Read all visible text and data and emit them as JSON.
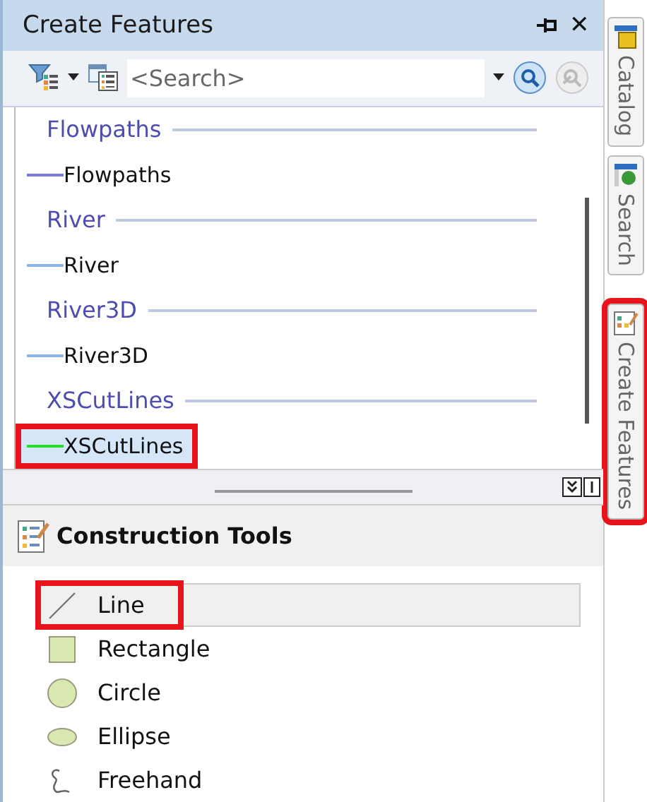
{
  "panel": {
    "title": "Create Features",
    "close_glyph": "✕"
  },
  "toolbar": {
    "search": {
      "placeholder": "<Search>"
    }
  },
  "templates": [
    {
      "group": "Flowpaths",
      "items": [
        {
          "name": "Flowpaths",
          "color": "#7b7bd8",
          "selected": false,
          "highlighted": false
        }
      ]
    },
    {
      "group": "River",
      "items": [
        {
          "name": "River",
          "color": "#8ab4e8",
          "selected": false,
          "highlighted": false
        }
      ]
    },
    {
      "group": "River3D",
      "items": [
        {
          "name": "River3D",
          "color": "#8ab4e8",
          "selected": false,
          "highlighted": false
        }
      ]
    },
    {
      "group": "XSCutLines",
      "items": [
        {
          "name": "XSCutLines",
          "color": "#22dd22",
          "selected": true,
          "highlighted": true
        }
      ]
    }
  ],
  "construction_tools": {
    "title": "Construction Tools",
    "tools": [
      {
        "kind": "line",
        "label": "Line",
        "selected": true,
        "highlighted": true
      },
      {
        "kind": "rectangle",
        "label": "Rectangle",
        "selected": false,
        "highlighted": false
      },
      {
        "kind": "circle",
        "label": "Circle",
        "selected": false,
        "highlighted": false
      },
      {
        "kind": "ellipse",
        "label": "Ellipse",
        "selected": false,
        "highlighted": false
      },
      {
        "kind": "freehand",
        "label": "Freehand",
        "selected": false,
        "highlighted": false
      }
    ]
  },
  "side_tabs": [
    {
      "kind": "catalog",
      "label": "Catalog",
      "highlighted": false
    },
    {
      "kind": "search",
      "label": "Search",
      "highlighted": false
    },
    {
      "kind": "create",
      "label": "Create Features",
      "highlighted": true
    }
  ]
}
